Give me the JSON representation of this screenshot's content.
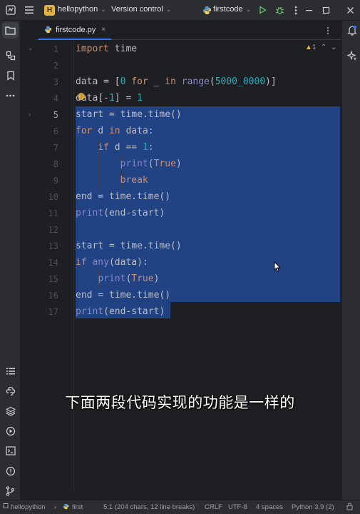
{
  "titlebar": {
    "project_badge": "H",
    "project_name": "hellopython",
    "vcs_label": "Version control",
    "run_config": "firstcode",
    "icons": [
      "app-menu-icon",
      "hamburger-icon",
      "python-icon",
      "run-icon",
      "debug-icon",
      "more-vertical-icon",
      "minimize-icon",
      "maximize-icon",
      "close-icon"
    ]
  },
  "tab": {
    "label": "firstcode.py",
    "close": "×"
  },
  "inspection": {
    "warnings": "1"
  },
  "code": {
    "line_numbers": [
      "1",
      "2",
      "3",
      "4",
      "5",
      "6",
      "7",
      "8",
      "9",
      "10",
      "11",
      "12",
      "13",
      "14",
      "15",
      "16",
      "17"
    ],
    "current_line": 5
  },
  "subtitle": "下面两段代码实现的功能是一样的",
  "statusbar": {
    "project": "hellopython",
    "file": "first",
    "position": "5:1 (204 chars, 12 line breaks)",
    "line_ending": "CRLF",
    "encoding": "UTF-8",
    "indent": "4 spaces",
    "interpreter": "Python 3.9 (2)"
  },
  "colors": {
    "keyword": "#cf8e6d",
    "builtin": "#8888c6",
    "number": "#2aacb8",
    "selection": "#214283",
    "accent": "#3574f0"
  }
}
